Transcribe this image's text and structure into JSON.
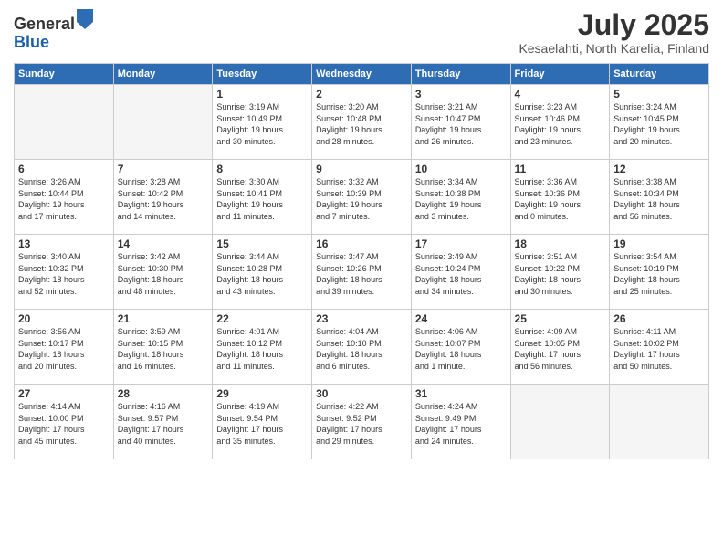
{
  "logo": {
    "general": "General",
    "blue": "Blue"
  },
  "title": "July 2025",
  "subtitle": "Kesaelahti, North Karelia, Finland",
  "headers": [
    "Sunday",
    "Monday",
    "Tuesday",
    "Wednesday",
    "Thursday",
    "Friday",
    "Saturday"
  ],
  "weeks": [
    [
      {
        "day": "",
        "info": ""
      },
      {
        "day": "",
        "info": ""
      },
      {
        "day": "1",
        "info": "Sunrise: 3:19 AM\nSunset: 10:49 PM\nDaylight: 19 hours\nand 30 minutes."
      },
      {
        "day": "2",
        "info": "Sunrise: 3:20 AM\nSunset: 10:48 PM\nDaylight: 19 hours\nand 28 minutes."
      },
      {
        "day": "3",
        "info": "Sunrise: 3:21 AM\nSunset: 10:47 PM\nDaylight: 19 hours\nand 26 minutes."
      },
      {
        "day": "4",
        "info": "Sunrise: 3:23 AM\nSunset: 10:46 PM\nDaylight: 19 hours\nand 23 minutes."
      },
      {
        "day": "5",
        "info": "Sunrise: 3:24 AM\nSunset: 10:45 PM\nDaylight: 19 hours\nand 20 minutes."
      }
    ],
    [
      {
        "day": "6",
        "info": "Sunrise: 3:26 AM\nSunset: 10:44 PM\nDaylight: 19 hours\nand 17 minutes."
      },
      {
        "day": "7",
        "info": "Sunrise: 3:28 AM\nSunset: 10:42 PM\nDaylight: 19 hours\nand 14 minutes."
      },
      {
        "day": "8",
        "info": "Sunrise: 3:30 AM\nSunset: 10:41 PM\nDaylight: 19 hours\nand 11 minutes."
      },
      {
        "day": "9",
        "info": "Sunrise: 3:32 AM\nSunset: 10:39 PM\nDaylight: 19 hours\nand 7 minutes."
      },
      {
        "day": "10",
        "info": "Sunrise: 3:34 AM\nSunset: 10:38 PM\nDaylight: 19 hours\nand 3 minutes."
      },
      {
        "day": "11",
        "info": "Sunrise: 3:36 AM\nSunset: 10:36 PM\nDaylight: 19 hours\nand 0 minutes."
      },
      {
        "day": "12",
        "info": "Sunrise: 3:38 AM\nSunset: 10:34 PM\nDaylight: 18 hours\nand 56 minutes."
      }
    ],
    [
      {
        "day": "13",
        "info": "Sunrise: 3:40 AM\nSunset: 10:32 PM\nDaylight: 18 hours\nand 52 minutes."
      },
      {
        "day": "14",
        "info": "Sunrise: 3:42 AM\nSunset: 10:30 PM\nDaylight: 18 hours\nand 48 minutes."
      },
      {
        "day": "15",
        "info": "Sunrise: 3:44 AM\nSunset: 10:28 PM\nDaylight: 18 hours\nand 43 minutes."
      },
      {
        "day": "16",
        "info": "Sunrise: 3:47 AM\nSunset: 10:26 PM\nDaylight: 18 hours\nand 39 minutes."
      },
      {
        "day": "17",
        "info": "Sunrise: 3:49 AM\nSunset: 10:24 PM\nDaylight: 18 hours\nand 34 minutes."
      },
      {
        "day": "18",
        "info": "Sunrise: 3:51 AM\nSunset: 10:22 PM\nDaylight: 18 hours\nand 30 minutes."
      },
      {
        "day": "19",
        "info": "Sunrise: 3:54 AM\nSunset: 10:19 PM\nDaylight: 18 hours\nand 25 minutes."
      }
    ],
    [
      {
        "day": "20",
        "info": "Sunrise: 3:56 AM\nSunset: 10:17 PM\nDaylight: 18 hours\nand 20 minutes."
      },
      {
        "day": "21",
        "info": "Sunrise: 3:59 AM\nSunset: 10:15 PM\nDaylight: 18 hours\nand 16 minutes."
      },
      {
        "day": "22",
        "info": "Sunrise: 4:01 AM\nSunset: 10:12 PM\nDaylight: 18 hours\nand 11 minutes."
      },
      {
        "day": "23",
        "info": "Sunrise: 4:04 AM\nSunset: 10:10 PM\nDaylight: 18 hours\nand 6 minutes."
      },
      {
        "day": "24",
        "info": "Sunrise: 4:06 AM\nSunset: 10:07 PM\nDaylight: 18 hours\nand 1 minute."
      },
      {
        "day": "25",
        "info": "Sunrise: 4:09 AM\nSunset: 10:05 PM\nDaylight: 17 hours\nand 56 minutes."
      },
      {
        "day": "26",
        "info": "Sunrise: 4:11 AM\nSunset: 10:02 PM\nDaylight: 17 hours\nand 50 minutes."
      }
    ],
    [
      {
        "day": "27",
        "info": "Sunrise: 4:14 AM\nSunset: 10:00 PM\nDaylight: 17 hours\nand 45 minutes."
      },
      {
        "day": "28",
        "info": "Sunrise: 4:16 AM\nSunset: 9:57 PM\nDaylight: 17 hours\nand 40 minutes."
      },
      {
        "day": "29",
        "info": "Sunrise: 4:19 AM\nSunset: 9:54 PM\nDaylight: 17 hours\nand 35 minutes."
      },
      {
        "day": "30",
        "info": "Sunrise: 4:22 AM\nSunset: 9:52 PM\nDaylight: 17 hours\nand 29 minutes."
      },
      {
        "day": "31",
        "info": "Sunrise: 4:24 AM\nSunset: 9:49 PM\nDaylight: 17 hours\nand 24 minutes."
      },
      {
        "day": "",
        "info": ""
      },
      {
        "day": "",
        "info": ""
      }
    ]
  ]
}
